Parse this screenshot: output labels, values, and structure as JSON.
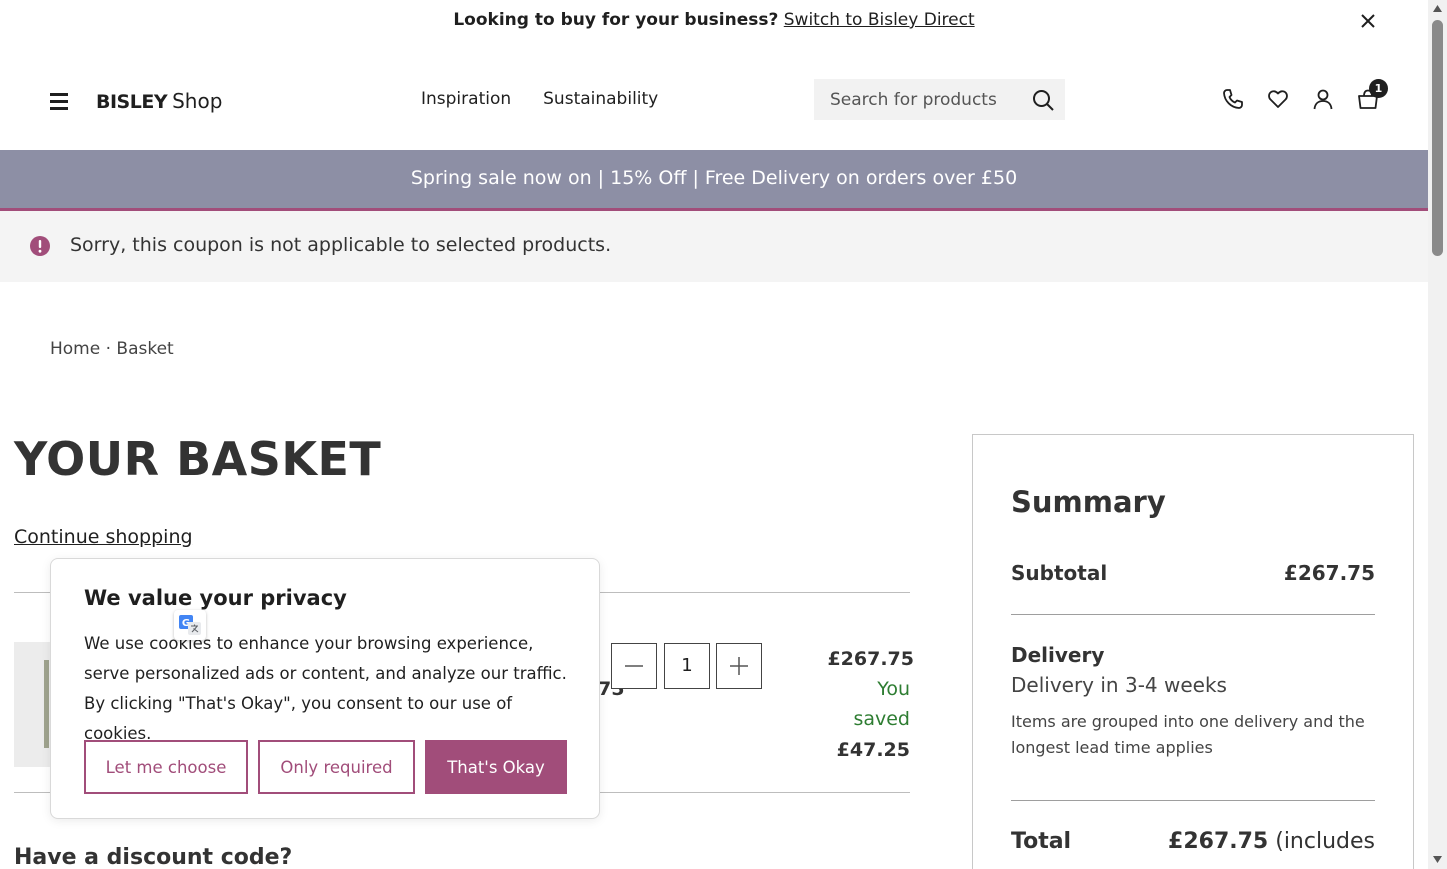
{
  "topbar": {
    "question": "Looking to buy for your business?",
    "link": "Switch to Bisley Direct"
  },
  "header": {
    "logo_brand": "BISLEY",
    "logo_shop": "Shop",
    "nav": [
      "Inspiration",
      "Sustainability"
    ],
    "search_placeholder": "Search for products",
    "basket_count": "1"
  },
  "promo": {
    "text": "Spring sale now on | 15% Off | Free Delivery on orders over £50"
  },
  "alert": {
    "text": "Sorry, this coupon is not applicable to selected products."
  },
  "breadcrumb": {
    "home": "Home",
    "separator": " · ",
    "current": "Basket"
  },
  "basket": {
    "title": "YOUR BASKET",
    "continue_label": "Continue shopping",
    "item": {
      "partial_price": "75",
      "quantity": "1",
      "price": "£267.75",
      "saved_line1": "You",
      "saved_line2": "saved",
      "saved_amount": "£47.25"
    },
    "discount_heading": "Have a discount code?"
  },
  "summary": {
    "title": "Summary",
    "subtotal_label": "Subtotal",
    "subtotal_value": "£267.75",
    "delivery_label": "Delivery",
    "delivery_time": "Delivery in 3-4 weeks",
    "delivery_note": "Items are grouped into one delivery and the longest lead time applies",
    "total_label": "Total",
    "total_value": "£267.75",
    "total_suffix": "(includes"
  },
  "cookie": {
    "title": "We value your privacy",
    "body": "We use cookies to enhance your browsing experience, serve personalized ads or content, and analyze our traffic. By clicking \"That's Okay\", you consent to our use of cookies.",
    "btn_choose": "Let me choose",
    "btn_required": "Only required",
    "btn_ok": "That's Okay"
  },
  "colors": {
    "accent": "#a14d7a",
    "promo_bg": "#8d8fa5",
    "saved_green": "#2e7d32"
  },
  "icons": [
    "close-icon",
    "menu-icon",
    "search-icon",
    "phone-icon",
    "heart-icon",
    "user-icon",
    "basket-icon",
    "alert-icon",
    "minus-icon",
    "plus-icon",
    "translate-icon"
  ]
}
